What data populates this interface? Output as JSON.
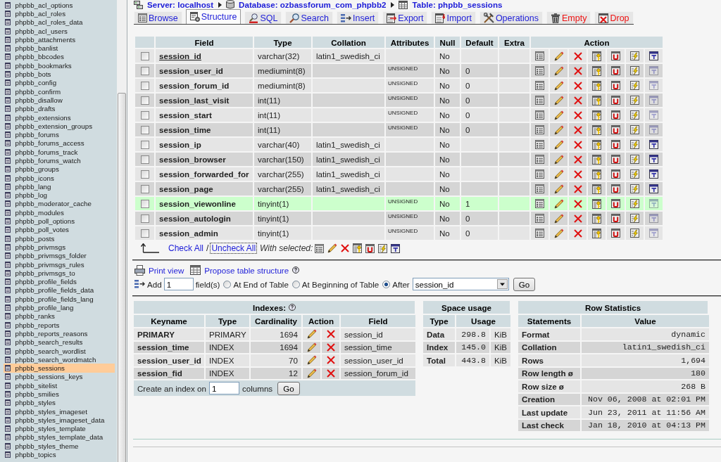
{
  "breadcrumb": [
    "Server: localhost",
    "Database: ozbassforum_com_phpbb2",
    "Table: phpbb_sessions"
  ],
  "sidebar": {
    "tables": [
      {
        "name": "phpbb_acl_options",
        "selected": false
      },
      {
        "name": "phpbb_acl_roles",
        "selected": false
      },
      {
        "name": "phpbb_acl_roles_data",
        "selected": false
      },
      {
        "name": "phpbb_acl_users",
        "selected": false
      },
      {
        "name": "phpbb_attachments",
        "selected": false
      },
      {
        "name": "phpbb_banlist",
        "selected": false
      },
      {
        "name": "phpbb_bbcodes",
        "selected": false
      },
      {
        "name": "phpbb_bookmarks",
        "selected": false
      },
      {
        "name": "phpbb_bots",
        "selected": false
      },
      {
        "name": "phpbb_config",
        "selected": false
      },
      {
        "name": "phpbb_confirm",
        "selected": false
      },
      {
        "name": "phpbb_disallow",
        "selected": false
      },
      {
        "name": "phpbb_drafts",
        "selected": false
      },
      {
        "name": "phpbb_extensions",
        "selected": false
      },
      {
        "name": "phpbb_extension_groups",
        "selected": false
      },
      {
        "name": "phpbb_forums",
        "selected": false
      },
      {
        "name": "phpbb_forums_access",
        "selected": false
      },
      {
        "name": "phpbb_forums_track",
        "selected": false
      },
      {
        "name": "phpbb_forums_watch",
        "selected": false
      },
      {
        "name": "phpbb_groups",
        "selected": false
      },
      {
        "name": "phpbb_icons",
        "selected": false
      },
      {
        "name": "phpbb_lang",
        "selected": false
      },
      {
        "name": "phpbb_log",
        "selected": false
      },
      {
        "name": "phpbb_moderator_cache",
        "selected": false
      },
      {
        "name": "phpbb_modules",
        "selected": false
      },
      {
        "name": "phpbb_poll_options",
        "selected": false
      },
      {
        "name": "phpbb_poll_votes",
        "selected": false
      },
      {
        "name": "phpbb_posts",
        "selected": false
      },
      {
        "name": "phpbb_privmsgs",
        "selected": false
      },
      {
        "name": "phpbb_privmsgs_folder",
        "selected": false
      },
      {
        "name": "phpbb_privmsgs_rules",
        "selected": false
      },
      {
        "name": "phpbb_privmsgs_to",
        "selected": false
      },
      {
        "name": "phpbb_profile_fields",
        "selected": false
      },
      {
        "name": "phpbb_profile_fields_data",
        "selected": false
      },
      {
        "name": "phpbb_profile_fields_lang",
        "selected": false
      },
      {
        "name": "phpbb_profile_lang",
        "selected": false
      },
      {
        "name": "phpbb_ranks",
        "selected": false
      },
      {
        "name": "phpbb_reports",
        "selected": false
      },
      {
        "name": "phpbb_reports_reasons",
        "selected": false
      },
      {
        "name": "phpbb_search_results",
        "selected": false
      },
      {
        "name": "phpbb_search_wordlist",
        "selected": false
      },
      {
        "name": "phpbb_search_wordmatch",
        "selected": false
      },
      {
        "name": "phpbb_sessions",
        "selected": true
      },
      {
        "name": "phpbb_sessions_keys",
        "selected": false
      },
      {
        "name": "phpbb_sitelist",
        "selected": false
      },
      {
        "name": "phpbb_smilies",
        "selected": false
      },
      {
        "name": "phpbb_styles",
        "selected": false
      },
      {
        "name": "phpbb_styles_imageset",
        "selected": false
      },
      {
        "name": "phpbb_styles_imageset_data",
        "selected": false
      },
      {
        "name": "phpbb_styles_template",
        "selected": false
      },
      {
        "name": "phpbb_styles_template_data",
        "selected": false
      },
      {
        "name": "phpbb_styles_theme",
        "selected": false
      },
      {
        "name": "phpbb_topics",
        "selected": false
      }
    ]
  },
  "tabs": [
    {
      "label": "Browse",
      "kind": "normal",
      "selected": false
    },
    {
      "label": "Structure",
      "kind": "normal",
      "selected": true
    },
    {
      "label": "SQL",
      "kind": "normal",
      "selected": false
    },
    {
      "label": "Search",
      "kind": "normal",
      "selected": false
    },
    {
      "label": "Insert",
      "kind": "normal",
      "selected": false
    },
    {
      "label": "Export",
      "kind": "normal",
      "selected": false
    },
    {
      "label": "Import",
      "kind": "normal",
      "selected": false
    },
    {
      "label": "Operations",
      "kind": "normal",
      "selected": false
    },
    {
      "label": "Empty",
      "kind": "danger",
      "selected": false
    },
    {
      "label": "Drop",
      "kind": "danger",
      "selected": false
    }
  ],
  "fields": {
    "columns": [
      "Field",
      "Type",
      "Collation",
      "Attributes",
      "Null",
      "Default",
      "Extra",
      "Action"
    ],
    "rows": [
      {
        "field": "session_id",
        "primary": true,
        "type": "varchar(32)",
        "collation": "latin1_swedish_ci",
        "null": "No",
        "checked": false,
        "marked": false,
        "last_icon_disabled": false
      },
      {
        "field": "session_user_id",
        "primary": false,
        "type": "mediumint(8)",
        "attributes": "UNSIGNED",
        "null": "No",
        "default": "0",
        "checked": false,
        "marked": false,
        "last_icon_disabled": true
      },
      {
        "field": "session_forum_id",
        "primary": false,
        "type": "mediumint(8)",
        "attributes": "UNSIGNED",
        "null": "No",
        "default": "0",
        "checked": false,
        "marked": false,
        "last_icon_disabled": true
      },
      {
        "field": "session_last_visit",
        "primary": false,
        "type": "int(11)",
        "attributes": "UNSIGNED",
        "null": "No",
        "default": "0",
        "checked": false,
        "marked": false,
        "last_icon_disabled": true
      },
      {
        "field": "session_start",
        "primary": false,
        "type": "int(11)",
        "attributes": "UNSIGNED",
        "null": "No",
        "default": "0",
        "checked": false,
        "marked": false,
        "last_icon_disabled": true
      },
      {
        "field": "session_time",
        "primary": false,
        "type": "int(11)",
        "attributes": "UNSIGNED",
        "null": "No",
        "default": "0",
        "checked": false,
        "marked": false,
        "last_icon_disabled": true
      },
      {
        "field": "session_ip",
        "primary": false,
        "type": "varchar(40)",
        "collation": "latin1_swedish_ci",
        "null": "No",
        "checked": false,
        "marked": false,
        "last_icon_disabled": false
      },
      {
        "field": "session_browser",
        "primary": false,
        "type": "varchar(150)",
        "collation": "latin1_swedish_ci",
        "null": "No",
        "checked": false,
        "marked": false,
        "last_icon_disabled": false
      },
      {
        "field": "session_forwarded_for",
        "primary": false,
        "type": "varchar(255)",
        "collation": "latin1_swedish_ci",
        "null": "No",
        "checked": false,
        "marked": false,
        "last_icon_disabled": false
      },
      {
        "field": "session_page",
        "primary": false,
        "type": "varchar(255)",
        "collation": "latin1_swedish_ci",
        "null": "No",
        "checked": false,
        "marked": false,
        "last_icon_disabled": false
      },
      {
        "field": "session_viewonline",
        "primary": false,
        "type": "tinyint(1)",
        "attributes": "UNSIGNED",
        "null": "No",
        "default": "1",
        "checked": false,
        "marked": true,
        "last_icon_disabled": true
      },
      {
        "field": "session_autologin",
        "primary": false,
        "type": "tinyint(1)",
        "attributes": "UNSIGNED",
        "null": "No",
        "default": "0",
        "checked": false,
        "marked": false,
        "last_icon_disabled": true
      },
      {
        "field": "session_admin",
        "primary": false,
        "type": "tinyint(1)",
        "attributes": "UNSIGNED",
        "null": "No",
        "default": "0",
        "checked": false,
        "marked": false,
        "last_icon_disabled": true
      }
    ]
  },
  "selection": {
    "links": [
      {
        "label": "Check All",
        "focused": false
      },
      {
        "label": "Uncheck All",
        "focused": true
      }
    ],
    "separator": "/",
    "with_selected": "With selected:"
  },
  "table_links": [
    "Print view",
    "Propose table structure"
  ],
  "add_fields": {
    "label": "Add",
    "count": "1",
    "unit": "field(s)",
    "positions": [
      {
        "label": "At End of Table",
        "selected": false
      },
      {
        "label": "At Beginning of Table",
        "selected": false
      },
      {
        "label": "After",
        "selected": true
      }
    ],
    "after_field": "session_id",
    "button": "Go"
  },
  "indexes": {
    "title": "Indexes:",
    "columns": [
      "Keyname",
      "Type",
      "Cardinality",
      "Action",
      "Field"
    ],
    "rows": [
      {
        "keyname": "PRIMARY",
        "type": "PRIMARY",
        "cardinality": "1694",
        "field": "session_id"
      },
      {
        "keyname": "session_time",
        "type": "INDEX",
        "cardinality": "1694",
        "field": "session_time"
      },
      {
        "keyname": "session_user_id",
        "type": "INDEX",
        "cardinality": "70",
        "field": "session_user_id"
      },
      {
        "keyname": "session_fid",
        "type": "INDEX",
        "cardinality": "12",
        "field": "session_forum_id"
      }
    ],
    "create": {
      "label": "Create an index on",
      "count": "1",
      "unit": "columns",
      "button": "Go"
    }
  },
  "space_usage": {
    "title": "Space usage",
    "columns": [
      "Type",
      "Usage"
    ],
    "rows": [
      {
        "type": "Data",
        "value": "298.8",
        "unit": "KiB"
      },
      {
        "type": "Index",
        "value": "145.0",
        "unit": "KiB"
      },
      {
        "type": "Total",
        "value": "443.8",
        "unit": "KiB"
      }
    ]
  },
  "row_statistics": {
    "title": "Row Statistics",
    "columns": [
      "Statements",
      "Value"
    ],
    "rows": [
      {
        "statement": "Format",
        "value": "dynamic"
      },
      {
        "statement": "Collation",
        "value": "latin1_swedish_ci"
      },
      {
        "statement": "Rows",
        "value": "1,694"
      },
      {
        "statement": "Row length ø",
        "value": "180"
      },
      {
        "statement": "Row size ø",
        "value": "268 B"
      },
      {
        "statement": "Creation",
        "value": "Nov 06, 2008 at 02:01 PM"
      },
      {
        "statement": "Last update",
        "value": "Jun 23, 2011 at 11:56 AM"
      },
      {
        "statement": "Last check",
        "value": "Jan 18, 2010 at 04:13 PM"
      }
    ]
  }
}
